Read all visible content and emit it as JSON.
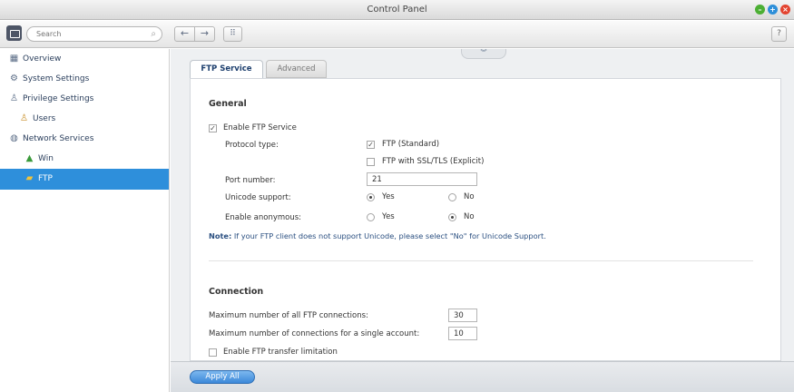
{
  "window": {
    "title": "Control Panel"
  },
  "toolbar": {
    "search_placeholder": "Search",
    "help_label": "?"
  },
  "sidebar": {
    "items": [
      {
        "label": "Overview",
        "icon": "overview-icon"
      },
      {
        "label": "System Settings",
        "icon": "gear-icon"
      },
      {
        "label": "Privilege Settings",
        "icon": "user-icon"
      },
      {
        "label": "Users",
        "icon": "user-icon"
      },
      {
        "label": "Network Services",
        "icon": "network-icon"
      },
      {
        "label": "Win",
        "icon": "win-icon"
      },
      {
        "label": "FTP",
        "icon": "folder-icon",
        "selected": true
      }
    ]
  },
  "tabs": [
    {
      "label": "FTP Service",
      "active": true
    },
    {
      "label": "Advanced",
      "active": false
    }
  ],
  "general": {
    "section_title": "General",
    "enable_ftp_label": "Enable FTP Service",
    "enable_ftp_checked": true,
    "protocol_type_label": "Protocol type:",
    "ftp_standard_label": "FTP (Standard)",
    "ftp_standard_checked": true,
    "ftp_ssl_label": "FTP with SSL/TLS (Explicit)",
    "ftp_ssl_checked": false,
    "port_number_label": "Port number:",
    "port_number_value": "21",
    "unicode_label": "Unicode support:",
    "unicode_yes_label": "Yes",
    "unicode_no_label": "No",
    "unicode_selected": "Yes",
    "anonymous_label": "Enable anonymous:",
    "anonymous_yes_label": "Yes",
    "anonymous_no_label": "No",
    "anonymous_selected": "No",
    "note_prefix": "Note:",
    "note_text": " If your FTP client does not support Unicode, please select \"No\" for Unicode Support."
  },
  "connection": {
    "section_title": "Connection",
    "max_all_label": "Maximum number of all FTP connections:",
    "max_all_value": "30",
    "max_single_label": "Maximum number of connections for a single account:",
    "max_single_value": "10",
    "transfer_limit_label": "Enable FTP transfer limitation",
    "transfer_limit_checked": false
  },
  "footer": {
    "apply_all_label": "Apply All"
  },
  "colors": {
    "accent": "#2e8fdb",
    "min_button": "#4caf34",
    "max_button": "#2d8fd9",
    "close_button": "#e3432f"
  }
}
